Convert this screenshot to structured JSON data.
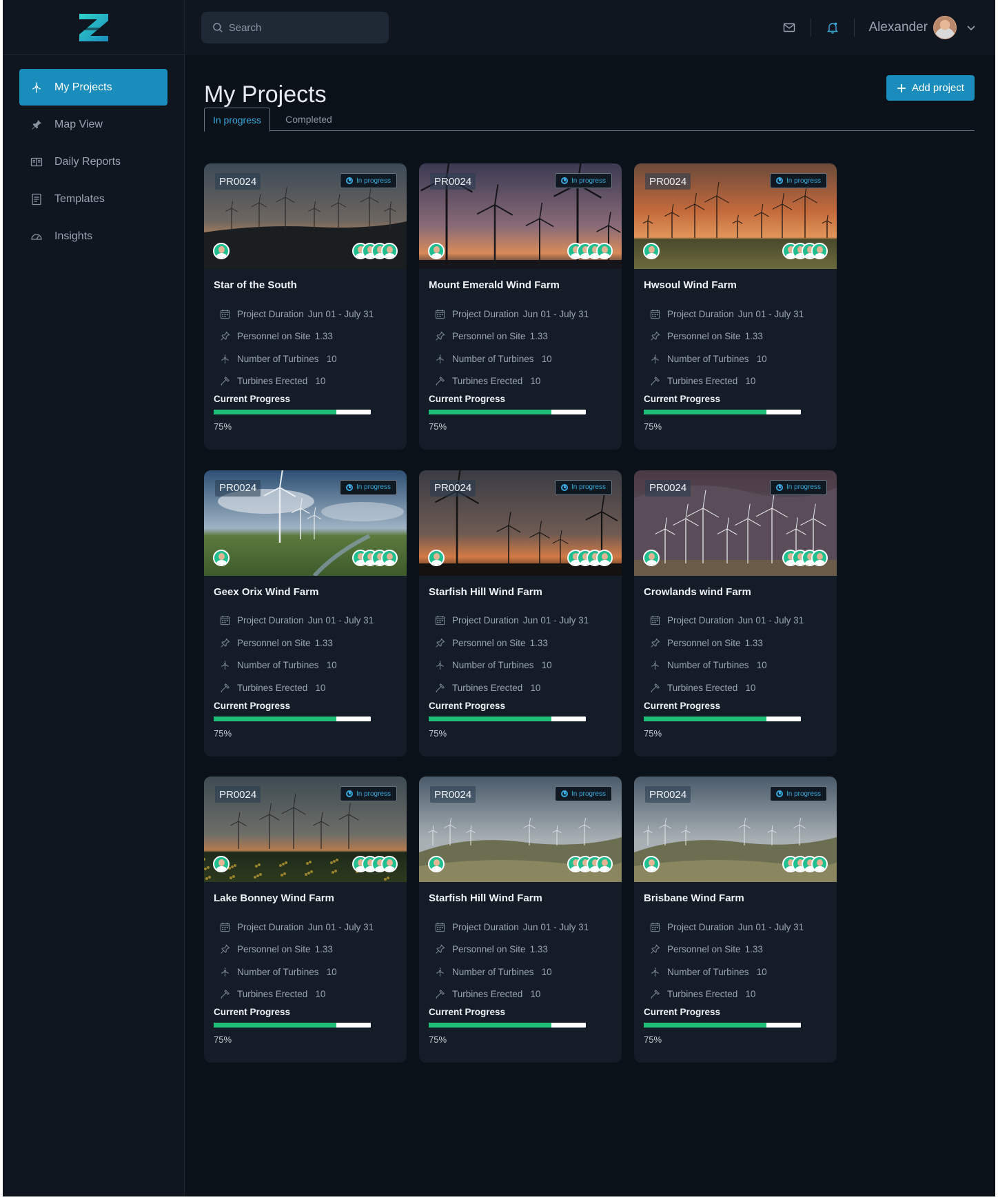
{
  "brand": {
    "logo_icon": "z-logo-icon",
    "accent": "#1b8dbd",
    "progress_color": "#1fbf7a"
  },
  "sidebar": {
    "items": [
      {
        "label": "My Projects",
        "icon": "turbine-icon",
        "active": true
      },
      {
        "label": "Map View",
        "icon": "pin-icon",
        "active": false
      },
      {
        "label": "Daily Reports",
        "icon": "book-icon",
        "active": false
      },
      {
        "label": "Templates",
        "icon": "document-icon",
        "active": false
      },
      {
        "label": "Insights",
        "icon": "gauge-icon",
        "active": false
      }
    ]
  },
  "header": {
    "search_placeholder": "Search",
    "user_name": "Alexander",
    "icons": [
      "mail-icon",
      "bell-icon",
      "avatar",
      "chevron-down-icon"
    ]
  },
  "page": {
    "title": "My Projects",
    "add_button": "Add project",
    "tabs": [
      {
        "label": "In progress",
        "active": true
      },
      {
        "label": "Completed",
        "active": false
      }
    ]
  },
  "labels": {
    "duration": "Project Duration",
    "personnel": "Personnel on Site",
    "turbines": "Number of Turbines",
    "erected": "Turbines Erected",
    "current_progress": "Current Progress"
  },
  "projects": [
    {
      "code": "PR0024",
      "status": "In progress",
      "title": "Star of the South",
      "duration": "Jun 01 - July 31",
      "personnel": "1.33",
      "turbines": "10",
      "erected": "10",
      "progress": 0.78,
      "progress_label": "75%",
      "scene": "dusk-distant"
    },
    {
      "code": "PR0024",
      "status": "In progress",
      "title": "Mount Emerald Wind Farm",
      "duration": "Jun 01 - July 31",
      "personnel": "1.33",
      "turbines": "10",
      "erected": "10",
      "progress": 0.78,
      "progress_label": "75%",
      "scene": "sunset-close"
    },
    {
      "code": "PR0024",
      "status": "In progress",
      "title": "Hwsoul Wind Farm",
      "duration": "Jun 01 - July 31",
      "personnel": "1.33",
      "turbines": "10",
      "erected": "10",
      "progress": 0.78,
      "progress_label": "75%",
      "scene": "orange-sky"
    },
    {
      "code": "PR0024",
      "status": "In progress",
      "title": "Geex Orix Wind Farm",
      "duration": "Jun 01 - July 31",
      "personnel": "1.33",
      "turbines": "10",
      "erected": "10",
      "progress": 0.78,
      "progress_label": "75%",
      "scene": "blue-sky"
    },
    {
      "code": "PR0024",
      "status": "In progress",
      "title": "Starfish Hill Wind Farm",
      "duration": "Jun 01 - July 31",
      "personnel": "1.33",
      "turbines": "10",
      "erected": "10",
      "progress": 0.78,
      "progress_label": "75%",
      "scene": "sunset-low"
    },
    {
      "code": "PR0024",
      "status": "In progress",
      "title": "Crowlands wind Farm",
      "duration": "Jun 01 - July 31",
      "personnel": "1.33",
      "turbines": "10",
      "erected": "10",
      "progress": 0.78,
      "progress_label": "75%",
      "scene": "mountain"
    },
    {
      "code": "PR0024",
      "status": "In progress",
      "title": "Lake Bonney Wind Farm",
      "duration": "Jun 01 - July 31",
      "personnel": "1.33",
      "turbines": "10",
      "erected": "10",
      "progress": 0.78,
      "progress_label": "75%",
      "scene": "flowers"
    },
    {
      "code": "PR0024",
      "status": "In progress",
      "title": "Starfish Hill Wind Farm",
      "duration": "Jun 01 - July 31",
      "personnel": "1.33",
      "turbines": "10",
      "erected": "10",
      "progress": 0.78,
      "progress_label": "75%",
      "scene": "hills"
    },
    {
      "code": "PR0024",
      "status": "In progress",
      "title": "Brisbane Wind Farm",
      "duration": "Jun 01 - July 31",
      "personnel": "1.33",
      "turbines": "10",
      "erected": "10",
      "progress": 0.78,
      "progress_label": "75%",
      "scene": "hills"
    }
  ]
}
